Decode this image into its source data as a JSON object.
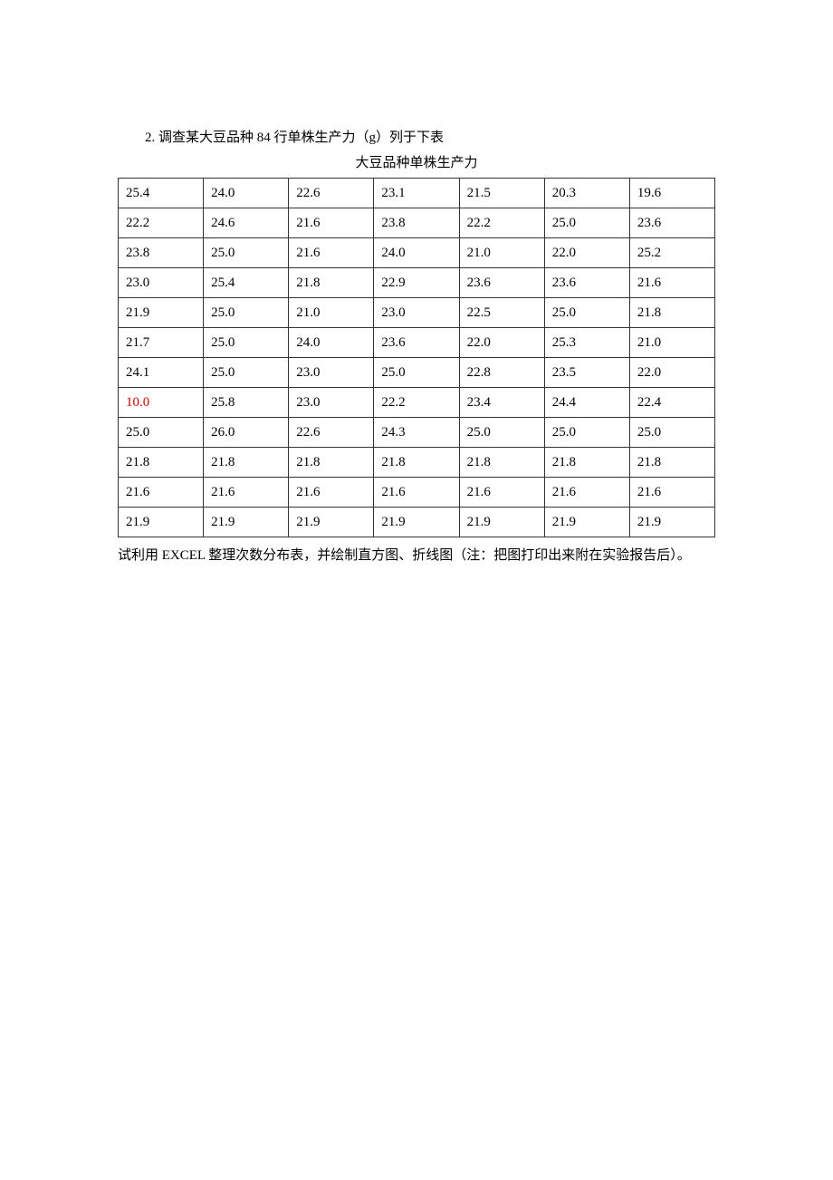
{
  "heading": "2. 调查某大豆品种 84 行单株生产力（g）列于下表",
  "table_title": "大豆品种单株生产力",
  "chart_data": {
    "type": "table",
    "title": "大豆品种单株生产力",
    "rows": [
      [
        "25.4",
        "24.0",
        "22.6",
        "23.1",
        "21.5",
        "20.3",
        "19.6"
      ],
      [
        "22.2",
        "24.6",
        "21.6",
        "23.8",
        "22.2",
        "25.0",
        "23.6"
      ],
      [
        "23.8",
        "25.0",
        "21.6",
        "24.0",
        "21.0",
        "22.0",
        "25.2"
      ],
      [
        "23.0",
        "25.4",
        "21.8",
        "22.9",
        "23.6",
        "23.6",
        "21.6"
      ],
      [
        "21.9",
        "25.0",
        "21.0",
        "23.0",
        "22.5",
        "25.0",
        "21.8"
      ],
      [
        "21.7",
        "25.0",
        "24.0",
        "23.6",
        "22.0",
        "25.3",
        "21.0"
      ],
      [
        "24.1",
        "25.0",
        "23.0",
        "25.0",
        "22.8",
        "23.5",
        "22.0"
      ],
      [
        "10.0",
        "25.8",
        "23.0",
        "22.2",
        "23.4",
        "24.4",
        "22.4"
      ],
      [
        "25.0",
        "26.0",
        "22.6",
        "24.3",
        "25.0",
        "25.0",
        "25.0"
      ],
      [
        "21.8",
        "21.8",
        "21.8",
        "21.8",
        "21.8",
        "21.8",
        "21.8"
      ],
      [
        "21.6",
        "21.6",
        "21.6",
        "21.6",
        "21.6",
        "21.6",
        "21.6"
      ],
      [
        "21.9",
        "21.9",
        "21.9",
        "21.9",
        "21.9",
        "21.9",
        "21.9"
      ]
    ],
    "highlighted": {
      "row": 7,
      "col": 0,
      "color": "#cc0000"
    }
  },
  "footnote": "试利用 EXCEL 整理次数分布表，并绘制直方图、折线图（注：把图打印出来附在实验报告后）。"
}
